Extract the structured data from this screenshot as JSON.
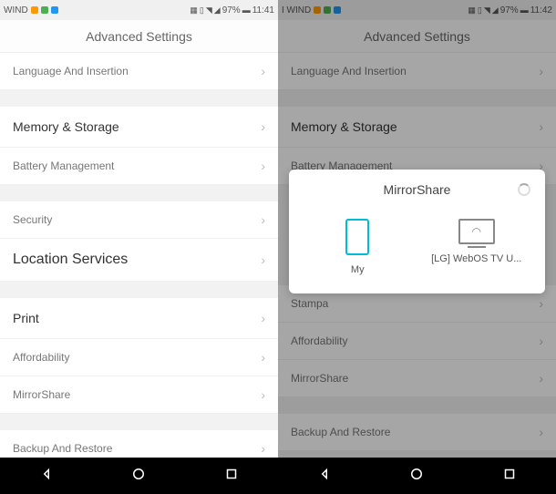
{
  "left": {
    "statusbar": {
      "carrier": "WIND",
      "battery": "97%",
      "time": "11:41"
    },
    "title": "Advanced Settings",
    "rows": {
      "language": "Language And Insertion",
      "memory": "Memory & Storage",
      "battery": "Battery Management",
      "security": "Security",
      "location": "Location Services",
      "print": "Print",
      "afford": "Affordability",
      "mirror": "MirrorShare",
      "backup": "Backup And Restore"
    }
  },
  "right": {
    "statusbar": {
      "carrier": "I WIND",
      "battery": "97%",
      "time": "11:42"
    },
    "title": "Advanced Settings",
    "rows": {
      "language": "Language And Insertion",
      "memory": "Memory & Storage",
      "battery": "Battery Management",
      "stampa": "Stampa",
      "afford": "Affordability",
      "mirror": "MirrorShare",
      "backup": "Backup And Restore"
    },
    "dialog": {
      "title": "MirrorShare",
      "dev1": "My",
      "dev2": "[LG] WebOS TV U..."
    }
  }
}
